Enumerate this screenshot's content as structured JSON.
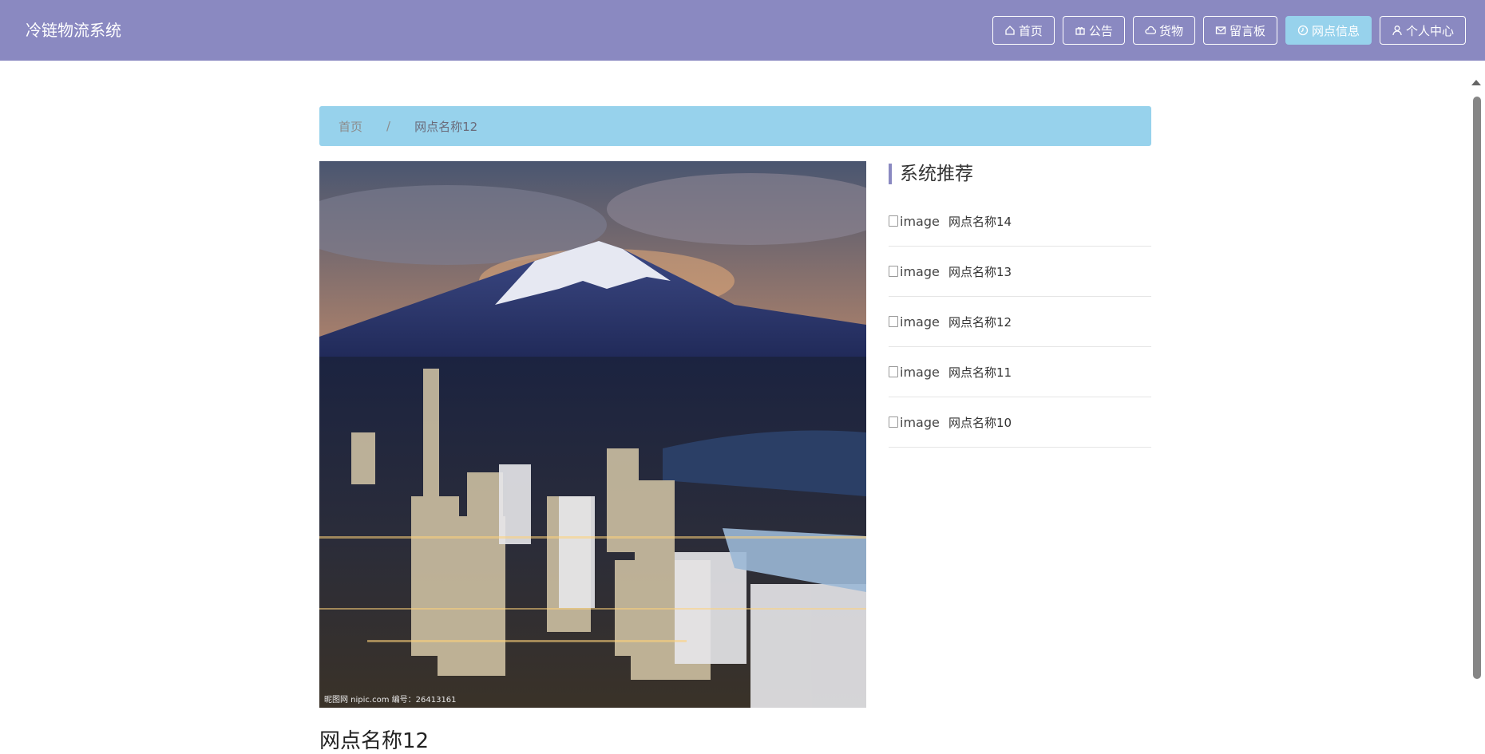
{
  "app": {
    "title": "冷链物流系统"
  },
  "nav": {
    "items": [
      {
        "label": "首页",
        "icon": "home-icon",
        "active": false
      },
      {
        "label": "公告",
        "icon": "gift-icon",
        "active": false
      },
      {
        "label": "货物",
        "icon": "cloud-icon",
        "active": false
      },
      {
        "label": "留言板",
        "icon": "mail-icon",
        "active": false
      },
      {
        "label": "网点信息",
        "icon": "clock-icon",
        "active": true
      },
      {
        "label": "个人中心",
        "icon": "user-icon",
        "active": false
      }
    ]
  },
  "breadcrumb": {
    "home": "首页",
    "separator": "/",
    "current": "网点名称12"
  },
  "detail": {
    "photo_credit": "昵图网 nipic.com 编号：26413161",
    "title": "网点名称12"
  },
  "sidebar": {
    "title": "系统推荐",
    "items": [
      {
        "image_alt": "image",
        "name": "网点名称14"
      },
      {
        "image_alt": "image",
        "name": "网点名称13"
      },
      {
        "image_alt": "image",
        "name": "网点名称12"
      },
      {
        "image_alt": "image",
        "name": "网点名称11"
      },
      {
        "image_alt": "image",
        "name": "网点名称10"
      }
    ]
  },
  "colors": {
    "nav_bg": "#8a89c1",
    "accent": "#97d2ec",
    "title_bar": "#8a89c1"
  }
}
